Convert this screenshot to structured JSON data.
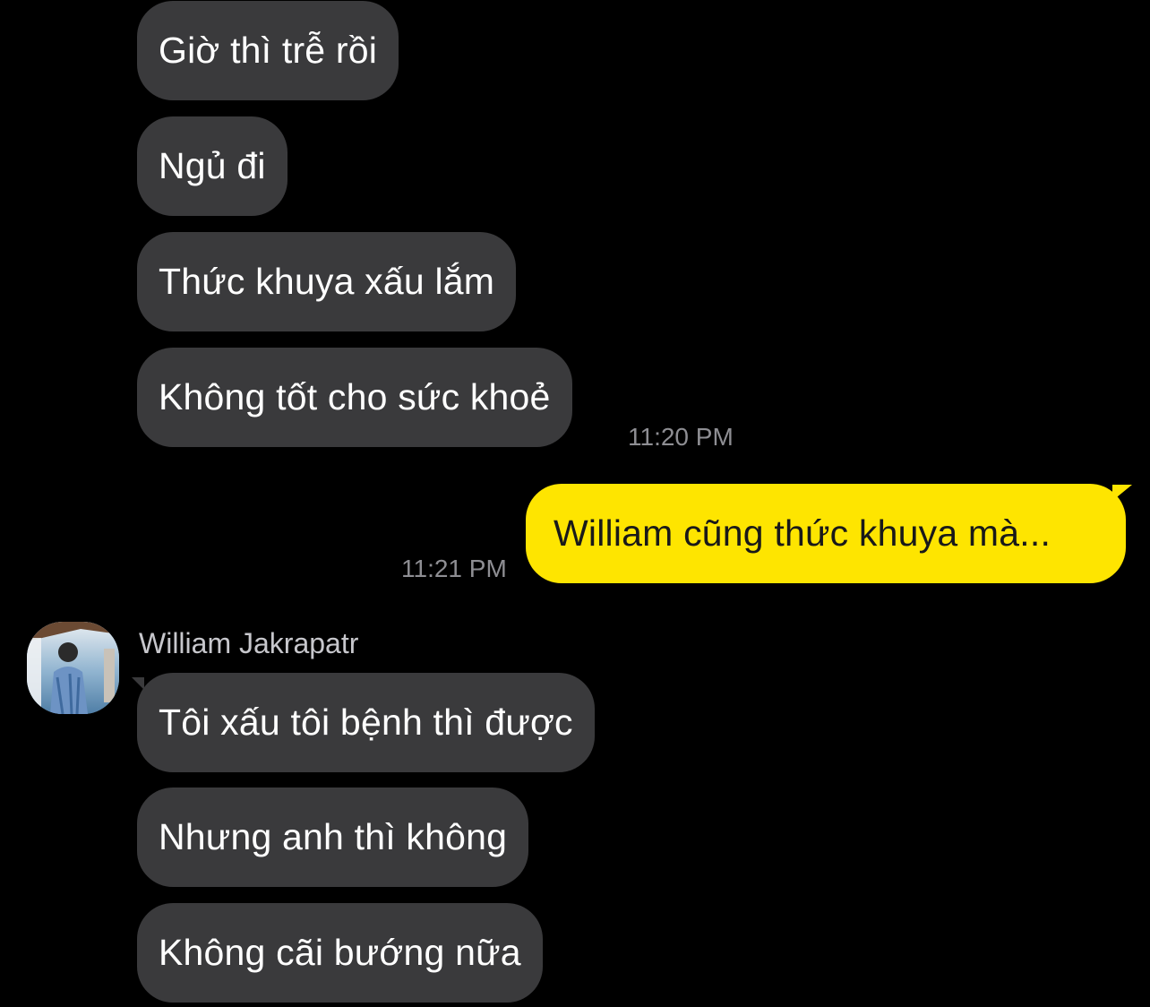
{
  "messages_before": [
    {
      "text": "Giờ thì trễ rồi"
    },
    {
      "text": "Ngủ đi"
    },
    {
      "text": "Thức khuya xấu lắm"
    },
    {
      "text": "Không tốt cho sức khoẻ"
    }
  ],
  "timestamp_1": "11:20 PM",
  "outgoing": {
    "text": "William cũng thức khuya mà...",
    "timestamp": "11:21 PM"
  },
  "sender": {
    "name": "William Jakrapatr"
  },
  "messages_after": [
    {
      "text": "Tôi xấu tôi bệnh thì được"
    },
    {
      "text": "Nhưng anh thì không"
    },
    {
      "text": "Không cãi bướng nữa"
    }
  ],
  "colors": {
    "background": "#000000",
    "incoming_bubble": "#3a3a3c",
    "outgoing_bubble": "#fee500",
    "timestamp": "#8e8e93"
  }
}
